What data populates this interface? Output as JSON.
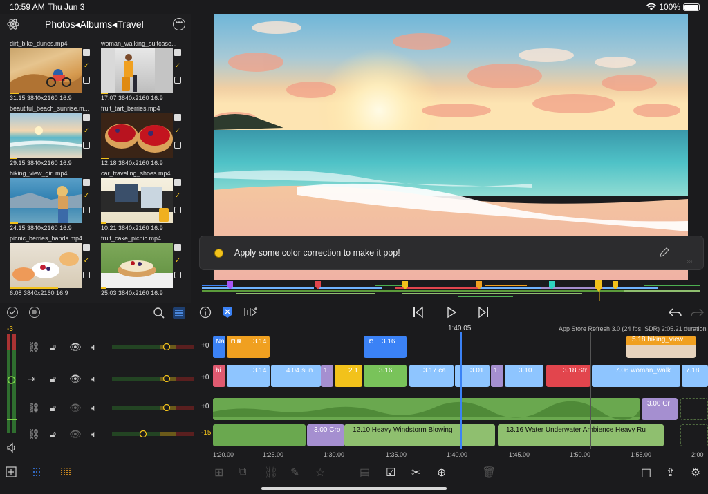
{
  "status": {
    "time": "10:59 AM",
    "date": "Thu Jun 3",
    "battery": "100%"
  },
  "browser": {
    "breadcrumb": "Photos◂Albums◂Travel",
    "clips": [
      {
        "name": "dirt_bike_dunes.mp4",
        "meta": "31.15  3840x2160  16:9"
      },
      {
        "name": "woman_walking_suitcase...",
        "meta": "17.07  3840x2160  16:9"
      },
      {
        "name": "beautiful_beach_sunrise.m...",
        "meta": "29.15  3840x2160  16:9"
      },
      {
        "name": "fruit_tart_berries.mp4",
        "meta": "12.18  3840x2160  16:9"
      },
      {
        "name": "hiking_view_girl.mp4",
        "meta": "24.15  3840x2160  16:9"
      },
      {
        "name": "car_traveling_shoes.mp4",
        "meta": "10.21  3840x2160  16:9"
      },
      {
        "name": "picnic_berries_hands.mp4",
        "meta": "6.08  3840x2160  16:9"
      },
      {
        "name": "fruit_cake_picnic.mp4",
        "meta": "25.03  3840x2160  16:9"
      }
    ]
  },
  "prompt": {
    "text": "Apply some color correction to make it pop!"
  },
  "timeline": {
    "playhead": "1:40.05",
    "project_info": "App Store Refresh 3.0 (24 fps, SDR)  2:05.21 duration",
    "ruler": [
      "1:20.00",
      "1:25.00",
      "1:30.00",
      "1:35.00",
      "1:40.00",
      "1:45.00",
      "1:50.00",
      "1:55.00",
      "2:00"
    ],
    "track_gains": [
      "+0",
      "+0",
      "+0",
      "-15"
    ],
    "meter_top": "-3",
    "v1_clips": [
      {
        "label": "Na"
      },
      {
        "label": "3.14"
      },
      {
        "label": "3.16"
      },
      {
        "label": "5.18  hiking_view"
      }
    ],
    "v2_clips": [
      {
        "label": "hi"
      },
      {
        "label": "3.14"
      },
      {
        "label": "4.04  sun"
      },
      {
        "label": "1."
      },
      {
        "label": "2.1"
      },
      {
        "label": "3.16"
      },
      {
        "label": "3.17  ca"
      },
      {
        "label": "3.01"
      },
      {
        "label": "1."
      },
      {
        "label": "3.10"
      },
      {
        "label": "3.18  Str"
      },
      {
        "label": "7.06  woman_walk"
      },
      {
        "label": "7.18"
      }
    ],
    "a1_clips": [
      {
        "label": "3.00  Cr"
      }
    ],
    "a2_clips": [
      {
        "label": "3.00  Cro"
      },
      {
        "label": "12.10  Heavy Windstorm Blowing"
      },
      {
        "label": "13.16  Water Underwater Ambience Heavy Ru"
      }
    ]
  }
}
